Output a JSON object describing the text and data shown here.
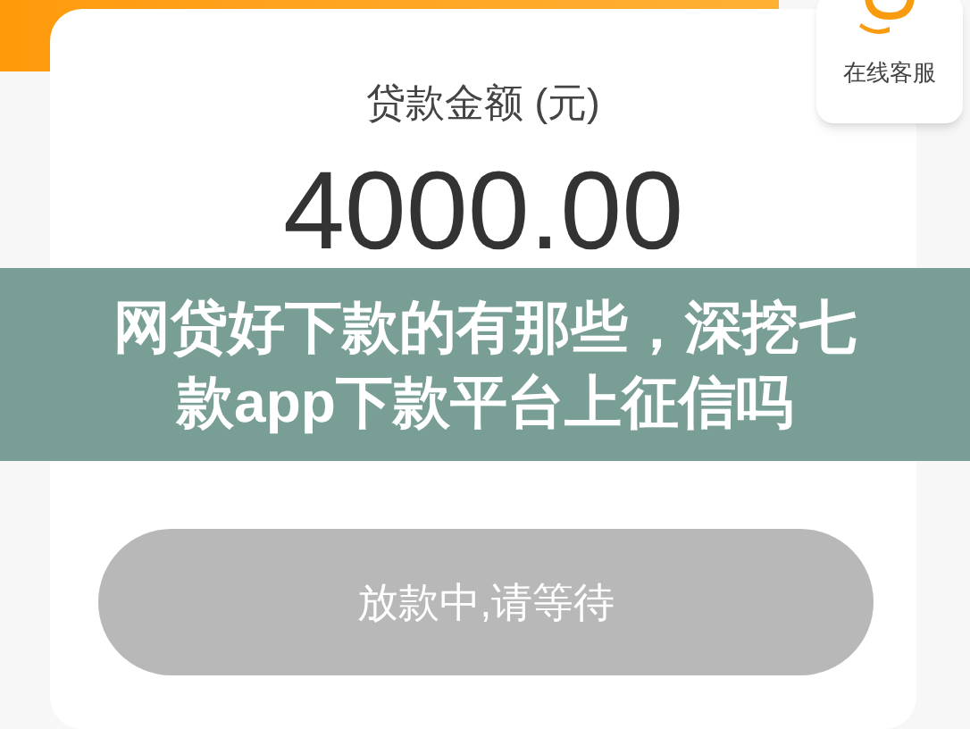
{
  "support": {
    "label": "在线客服"
  },
  "loan": {
    "label": "贷款金额 (元)",
    "amount": "4000.00"
  },
  "banner": {
    "title": "网贷好下款的有那些，深挖七款app下款平台上征信吗"
  },
  "action_button": {
    "label": "放款中,请等待",
    "disabled": true
  }
}
